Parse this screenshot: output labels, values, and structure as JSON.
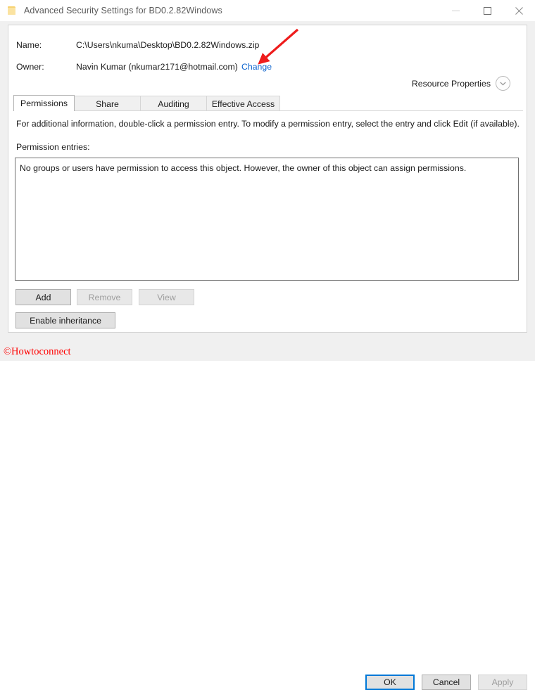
{
  "window": {
    "title": "Advanced Security Settings for BD0.2.82Windows",
    "icon": "folder-icon",
    "controls": {
      "minimize": "minimize-icon",
      "maximize": "maximize-icon",
      "close": "close-icon"
    }
  },
  "header": {
    "name_label": "Name:",
    "name_value": "C:\\Users\\nkuma\\Desktop\\BD0.2.82Windows.zip",
    "owner_label": "Owner:",
    "owner_value": "Navin Kumar (nkumar2171@hotmail.com)",
    "change_link": "Change",
    "resource_properties_label": "Resource Properties",
    "resource_properties_icon": "chevron-down-circle-icon"
  },
  "tabs": [
    {
      "label": "Permissions",
      "active": true
    },
    {
      "label": "Share",
      "active": false
    },
    {
      "label": "Auditing",
      "active": false
    },
    {
      "label": "Effective Access",
      "active": false
    }
  ],
  "permissions_tab": {
    "info_text": "For additional information, double-click a permission entry. To modify a permission entry, select the entry and click Edit (if available).",
    "entries_label": "Permission entries:",
    "list_empty_message": "No groups or users have permission to access this object. However, the owner of this object can assign permissions.",
    "buttons": [
      {
        "label": "Add",
        "enabled": true
      },
      {
        "label": "Remove",
        "enabled": false
      },
      {
        "label": "View",
        "enabled": false
      }
    ],
    "inheritance_button": {
      "label": "Enable inheritance",
      "enabled": true
    }
  },
  "footer": {
    "ok": {
      "label": "OK",
      "enabled": true,
      "focused": true
    },
    "cancel": {
      "label": "Cancel",
      "enabled": true
    },
    "apply": {
      "label": "Apply",
      "enabled": false
    }
  },
  "annotation": {
    "arrow_color": "#ee1c1c",
    "points_to": "Change"
  },
  "watermark": {
    "text": "©Howtoconnect",
    "color": "#ff0000"
  },
  "colors": {
    "link": "#0b63ce",
    "focus_border": "#0078d7",
    "button_face": "#e1e1e1",
    "dialog_face": "#f0f0f0"
  }
}
